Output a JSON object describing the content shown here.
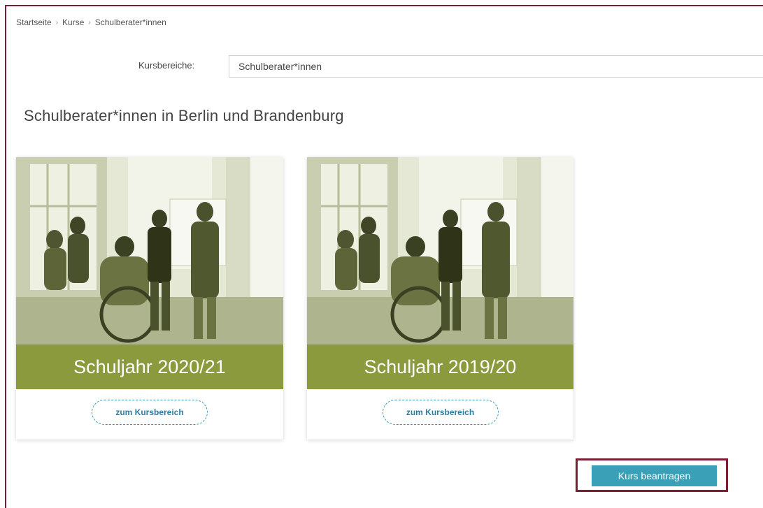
{
  "breadcrumb": {
    "items": [
      "Startseite",
      "Kurse",
      "Schulberater*innen"
    ],
    "separator": "›"
  },
  "filter": {
    "label": "Kursbereiche:",
    "selected": "Schulberater*innen"
  },
  "page": {
    "title": "Schulberater*innen in Berlin und Brandenburg"
  },
  "cards": [
    {
      "title": "Schuljahr 2020/21",
      "cta": "zum Kursbereich",
      "image_icon": "meeting-photo"
    },
    {
      "title": "Schuljahr 2019/20",
      "cta": "zum Kursbereich",
      "image_icon": "meeting-photo"
    }
  ],
  "actions": {
    "apply_label": "Kurs beantragen"
  },
  "colors": {
    "banner": "#8a9a3c",
    "button": "#3aa0b7",
    "frame": "#7a1f33",
    "link": "#2b7ea0"
  }
}
